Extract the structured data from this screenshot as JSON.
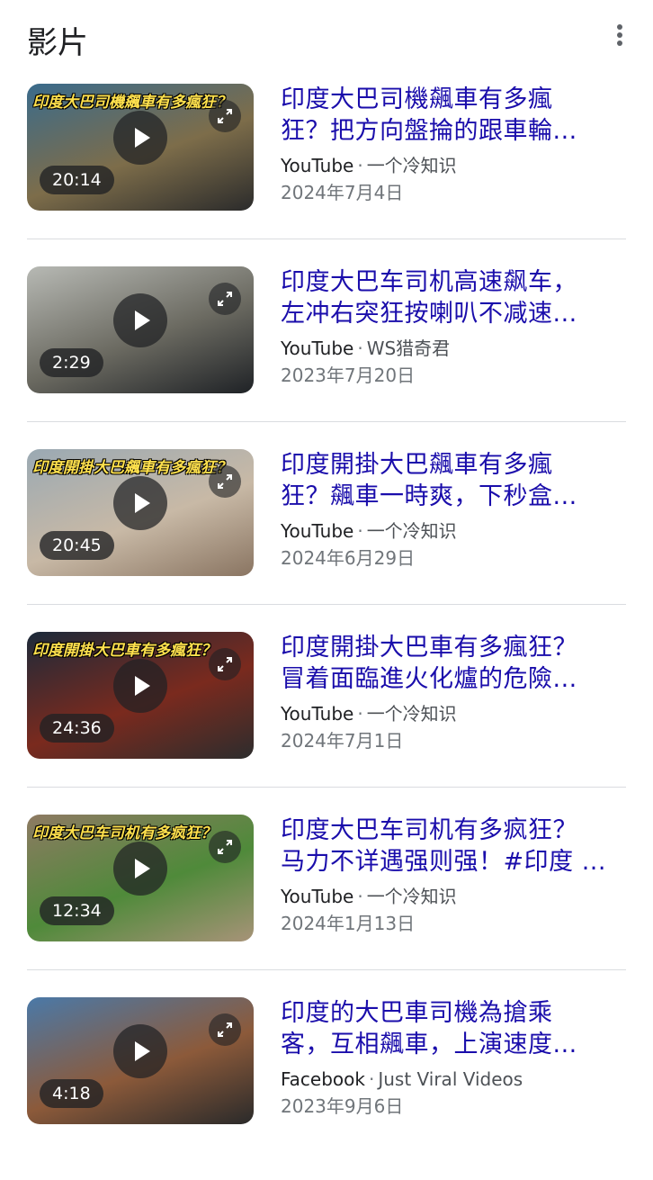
{
  "header": {
    "title": "影片",
    "more_icon": "more-vert-icon"
  },
  "videos": [
    {
      "title_line1": "印度大巴司機飆車有多瘋",
      "title_line2": "狂？把方向盤掄的跟車輪...",
      "source": "YouTube",
      "channel": "一个冷知识",
      "date": "2024年7月4日",
      "duration": "20:14",
      "thumb_text": "印度大巴司機飆車有多瘋狂？",
      "thumb_colors": [
        "#3a6b8c",
        "#7d6d4a",
        "#2b2b2b"
      ]
    },
    {
      "title_line1": "印度大巴车司机高速飙车，",
      "title_line2": "左冲右突狂按喇叭不减速...",
      "source": "YouTube",
      "channel": "WS猎奇君",
      "date": "2023年7月20日",
      "duration": "2:29",
      "thumb_text": "",
      "thumb_colors": [
        "#b7b9b4",
        "#6b6a61",
        "#1f2226"
      ]
    },
    {
      "title_line1": "印度開掛大巴飆車有多瘋",
      "title_line2": "狂？飆車一時爽，下秒盒...",
      "source": "YouTube",
      "channel": "一个冷知识",
      "date": "2024年6月29日",
      "duration": "20:45",
      "thumb_text": "印度開掛大巴飆車有多瘋狂？",
      "thumb_colors": [
        "#9aa9b3",
        "#c8b9a6",
        "#8a7562"
      ]
    },
    {
      "title_line1": "印度開掛大巴車有多瘋狂？",
      "title_line2": "冒着面臨進火化爐的危險...",
      "source": "YouTube",
      "channel": "一个冷知识",
      "date": "2024年7月1日",
      "duration": "24:36",
      "thumb_text": "印度開掛大巴車有多瘋狂？",
      "thumb_colors": [
        "#1c2a3a",
        "#7a2a1e",
        "#2d2d2d"
      ]
    },
    {
      "title_line1": "印度大巴车司机有多疯狂？",
      "title_line2": "马力不详遇强则强！#印度 ...",
      "source": "YouTube",
      "channel": "一个冷知识",
      "date": "2024年1月13日",
      "duration": "12:34",
      "thumb_text": "印度大巴车司机有多疯狂？",
      "thumb_colors": [
        "#8e7a63",
        "#4f8a3a",
        "#a79378"
      ]
    },
    {
      "title_line1": "印度的大巴車司機為搶乘",
      "title_line2": "客，互相飆車，上演速度...",
      "source": "Facebook",
      "channel": "Just Viral Videos",
      "date": "2023年9月6日",
      "duration": "4:18",
      "thumb_text": "",
      "thumb_colors": [
        "#4a79a8",
        "#8c5a3a",
        "#2a2a2a"
      ]
    }
  ]
}
